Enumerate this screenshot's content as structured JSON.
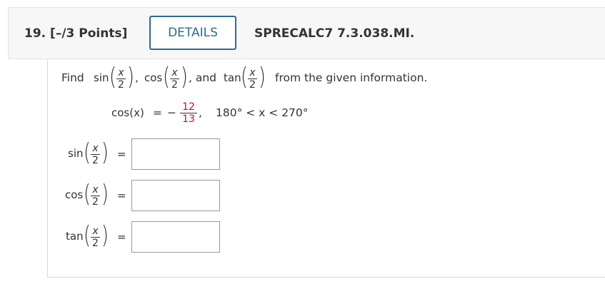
{
  "header": {
    "question_number": "19.",
    "points": "[–/3 Points]",
    "details_label": "DETAILS",
    "problem_code": "SPRECALC7 7.3.038.MI."
  },
  "prompt": {
    "find": "Find",
    "sin": "sin",
    "cos": "cos",
    "tan": "tan",
    "comma": ",",
    "and": ", and",
    "tail": "from the given information.",
    "x_var": "x",
    "two": "2"
  },
  "given": {
    "lhs": "cos(x)",
    "equals": "=",
    "minus": "−",
    "numerator": "12",
    "denominator": "13",
    "comma": ",",
    "condition": "180° < x < 270°"
  },
  "answers": [
    {
      "fn": "sin",
      "equals": "=",
      "value": ""
    },
    {
      "fn": "cos",
      "equals": "=",
      "value": ""
    },
    {
      "fn": "tan",
      "equals": "=",
      "value": ""
    }
  ]
}
